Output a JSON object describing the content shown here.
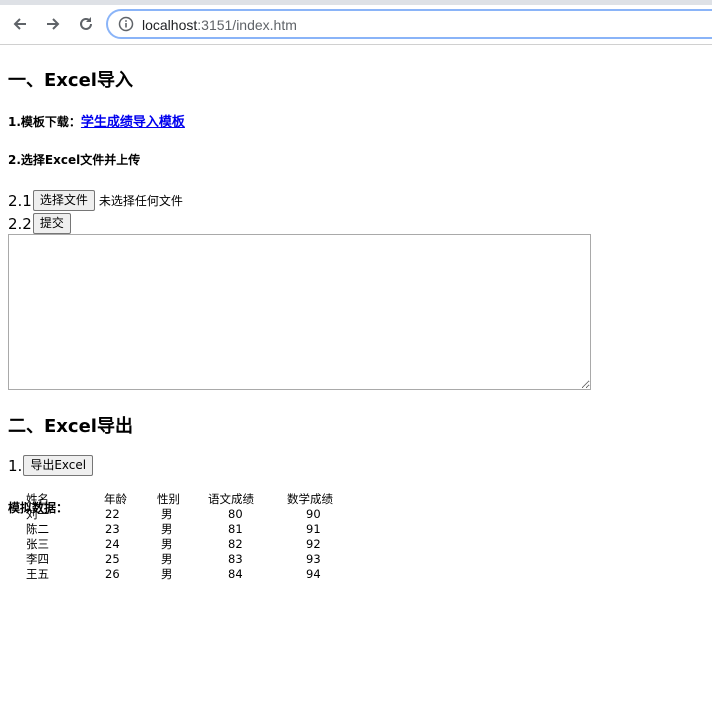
{
  "browser": {
    "url_host": "localhost",
    "url_rest": ":3151/index.htm",
    "icons": [
      "back-arrow-icon",
      "forward-arrow-icon",
      "reload-icon",
      "info-icon"
    ]
  },
  "import_section": {
    "title": "一、Excel导入",
    "template_label": "1.模板下载：",
    "template_link": "学生成绩导入模板",
    "upload_heading": "2.选择Excel文件并上传",
    "step_1_prefix": "2.1",
    "choose_file_button": "选择文件",
    "file_status": "未选择任何文件",
    "step_2_prefix": "2.2",
    "submit_button": "提交"
  },
  "export_section": {
    "title": "二、Excel导出",
    "step_prefix": "1.",
    "export_button": "导出Excel"
  },
  "mock_data": {
    "heading": "模拟数据：",
    "columns": [
      "姓名",
      "年龄",
      "性别",
      "语文成绩",
      "数学成绩"
    ],
    "rows": [
      [
        "刘一",
        "22",
        "男",
        "80",
        "90"
      ],
      [
        "陈二",
        "23",
        "男",
        "81",
        "91"
      ],
      [
        "张三",
        "24",
        "男",
        "82",
        "92"
      ],
      [
        "李四",
        "25",
        "男",
        "83",
        "93"
      ],
      [
        "王五",
        "26",
        "男",
        "84",
        "94"
      ]
    ]
  }
}
